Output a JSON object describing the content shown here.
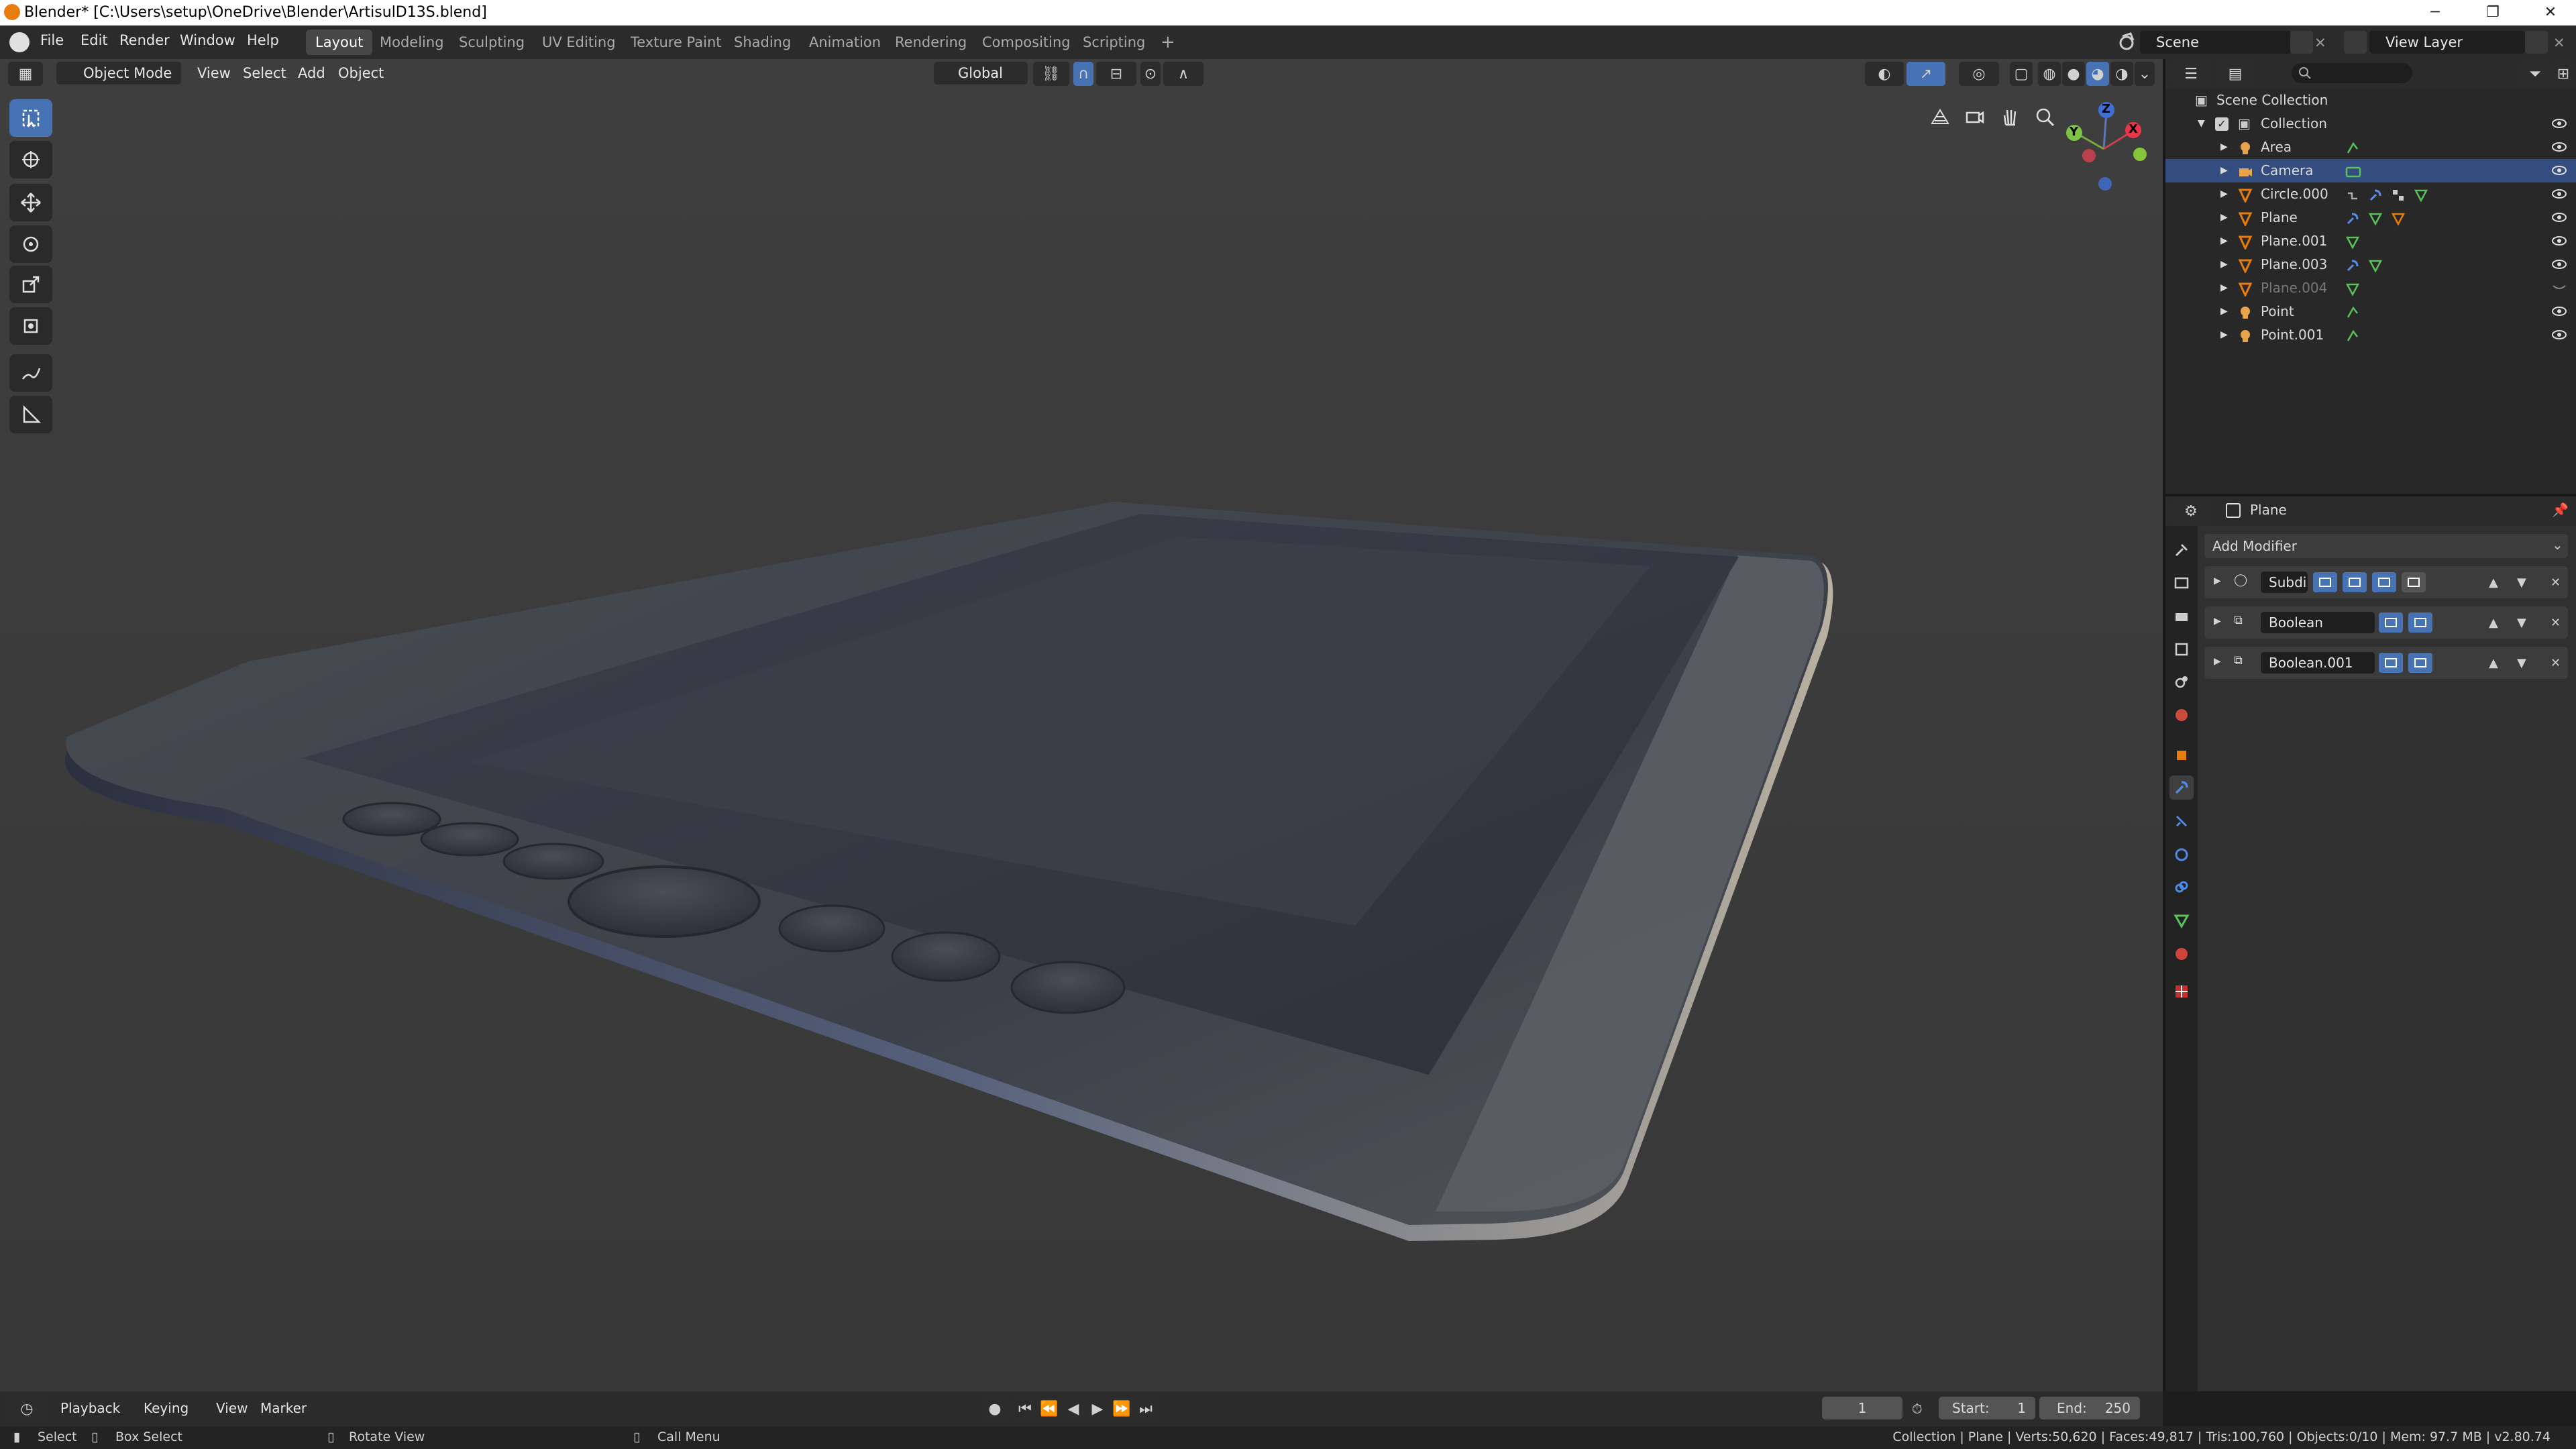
{
  "window": {
    "title": "Blender* [C:\\Users\\setup\\OneDrive\\Blender\\ArtisulD13S.blend]",
    "minimize": "─",
    "restore": "❐",
    "close": "✕"
  },
  "menus": [
    "File",
    "Edit",
    "Render",
    "Window",
    "Help"
  ],
  "workspaces": [
    {
      "label": "Layout",
      "active": true
    },
    {
      "label": "Modeling"
    },
    {
      "label": "Sculpting"
    },
    {
      "label": "UV Editing"
    },
    {
      "label": "Texture Paint"
    },
    {
      "label": "Shading"
    },
    {
      "label": "Animation"
    },
    {
      "label": "Rendering"
    },
    {
      "label": "Compositing"
    },
    {
      "label": "Scripting"
    }
  ],
  "add_workspace": "+",
  "scene": {
    "label": "Scene",
    "view_layer": "View Layer"
  },
  "viewport_header": {
    "mode": "Object Mode",
    "menus": [
      "View",
      "Select",
      "Add",
      "Object"
    ],
    "orientation": "Global"
  },
  "gizmo": {
    "z": "Z",
    "x": "X",
    "y": "Y"
  },
  "outliner": {
    "root": "Scene Collection",
    "collection": "Collection",
    "items": [
      {
        "name": "Area",
        "icon": "light-icon",
        "extras": [
          "light-data-icon"
        ]
      },
      {
        "name": "Camera",
        "icon": "camera-icon",
        "selected": true,
        "extras": [
          "camera-data-icon"
        ]
      },
      {
        "name": "Circle.000",
        "icon": "mesh-icon",
        "extras": [
          "constraint-icon",
          "modifier-icon",
          "particles-icon",
          "mesh-data-icon"
        ]
      },
      {
        "name": "Plane",
        "icon": "mesh-icon",
        "extras": [
          "modifier-icon",
          "mesh-data-icon",
          "material-icon"
        ]
      },
      {
        "name": "Plane.001",
        "icon": "mesh-icon",
        "extras": [
          "mesh-data-icon"
        ]
      },
      {
        "name": "Plane.003",
        "icon": "mesh-icon",
        "extras": [
          "modifier-icon",
          "mesh-data-icon"
        ]
      },
      {
        "name": "Plane.004",
        "icon": "mesh-icon",
        "dim": true,
        "extras": [
          "mesh-data-icon"
        ]
      },
      {
        "name": "Point",
        "icon": "light-icon",
        "extras": [
          "light-data-icon"
        ]
      },
      {
        "name": "Point.001",
        "icon": "light-icon",
        "extras": [
          "light-data-icon"
        ]
      }
    ]
  },
  "properties": {
    "object_name": "Plane",
    "add_modifier": "Add Modifier",
    "modifiers": [
      {
        "name": "Subdi",
        "type": "subdivision-icon"
      },
      {
        "name": "Boolean",
        "type": "boolean-icon"
      },
      {
        "name": "Boolean.001",
        "type": "boolean-icon"
      }
    ]
  },
  "timeline": {
    "menus": [
      "Playback",
      "Keying",
      "View",
      "Marker"
    ],
    "current_frame": "1",
    "start_label": "Start:",
    "start": "1",
    "end_label": "End:",
    "end": "250"
  },
  "statusbar": {
    "select": "Select",
    "box_select": "Box Select",
    "rotate_view": "Rotate View",
    "call_menu": "Call Menu",
    "stats": "Collection | Plane | Verts:50,620 | Faces:49,817 | Tris:100,760 | Objects:0/10 | Mem: 97.7 MB | v2.80.74"
  },
  "colors": {
    "accent": "#4772b3",
    "selection": "#334d80",
    "mesh": "#e87d0d"
  }
}
